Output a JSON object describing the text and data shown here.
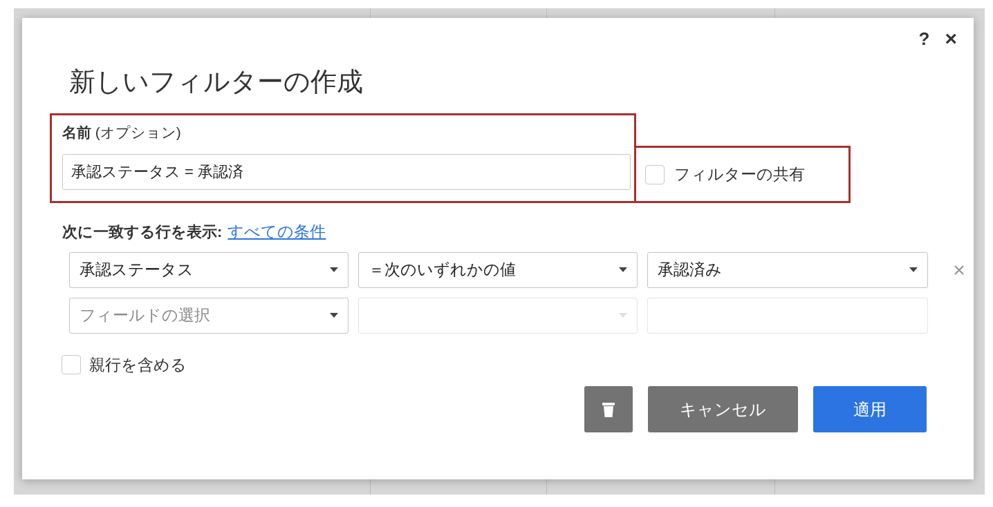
{
  "dialog": {
    "title": "新しいフィルターの作成",
    "help": "?",
    "close": "×"
  },
  "name_field": {
    "label": "**名前** (オプション)",
    "value": "承認ステータス = 承認済",
    "highlighted": true
  },
  "share": {
    "label": "フィルターの共有",
    "checked": false,
    "highlighted": true
  },
  "match": {
    "label": "次に一致する行を表示:",
    "link": "すべての条件"
  },
  "conditions": [
    {
      "field": "承認ステータス",
      "operator": "＝次のいずれかの値",
      "value": "承認済み",
      "disabled": false,
      "removable": true
    },
    {
      "field_placeholder": "フィールドの選択",
      "disabled": true,
      "removable": false
    }
  ],
  "include_parents": {
    "label": "親行を含める",
    "checked": false
  },
  "buttons": [
    {
      "kind": "delete"
    },
    {
      "kind": "secondary",
      "label": "キャンセル"
    },
    {
      "kind": "primary",
      "label": "適用"
    }
  ]
}
